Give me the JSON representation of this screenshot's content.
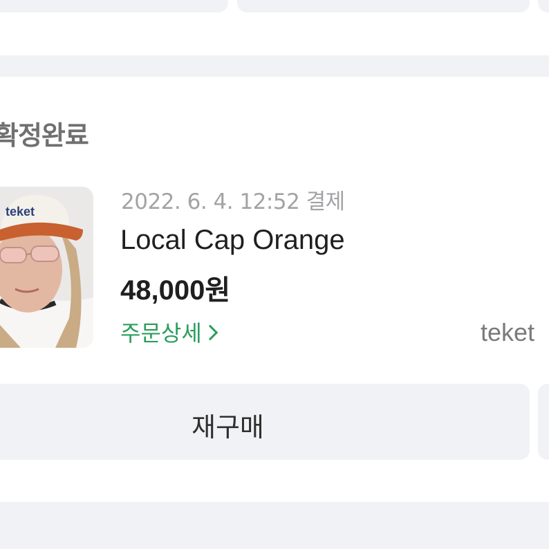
{
  "order": {
    "status": "확정완료",
    "date": "2022. 6. 4. 12:52 결제",
    "product_name": "Local Cap Orange",
    "price": "48,000원",
    "detail_link": "주문상세",
    "seller": "teket",
    "thumbnail_alt": "Local Cap Orange product photo",
    "thumbnail_cap_text": "teket"
  },
  "actions": {
    "rebuy_label": "재구매"
  },
  "colors": {
    "link_green": "#2a9d5c",
    "band_gray": "#f1f2f5",
    "date_gray": "#a3a3a6",
    "title_gray": "#707070",
    "cap_orange": "#c8602f"
  }
}
